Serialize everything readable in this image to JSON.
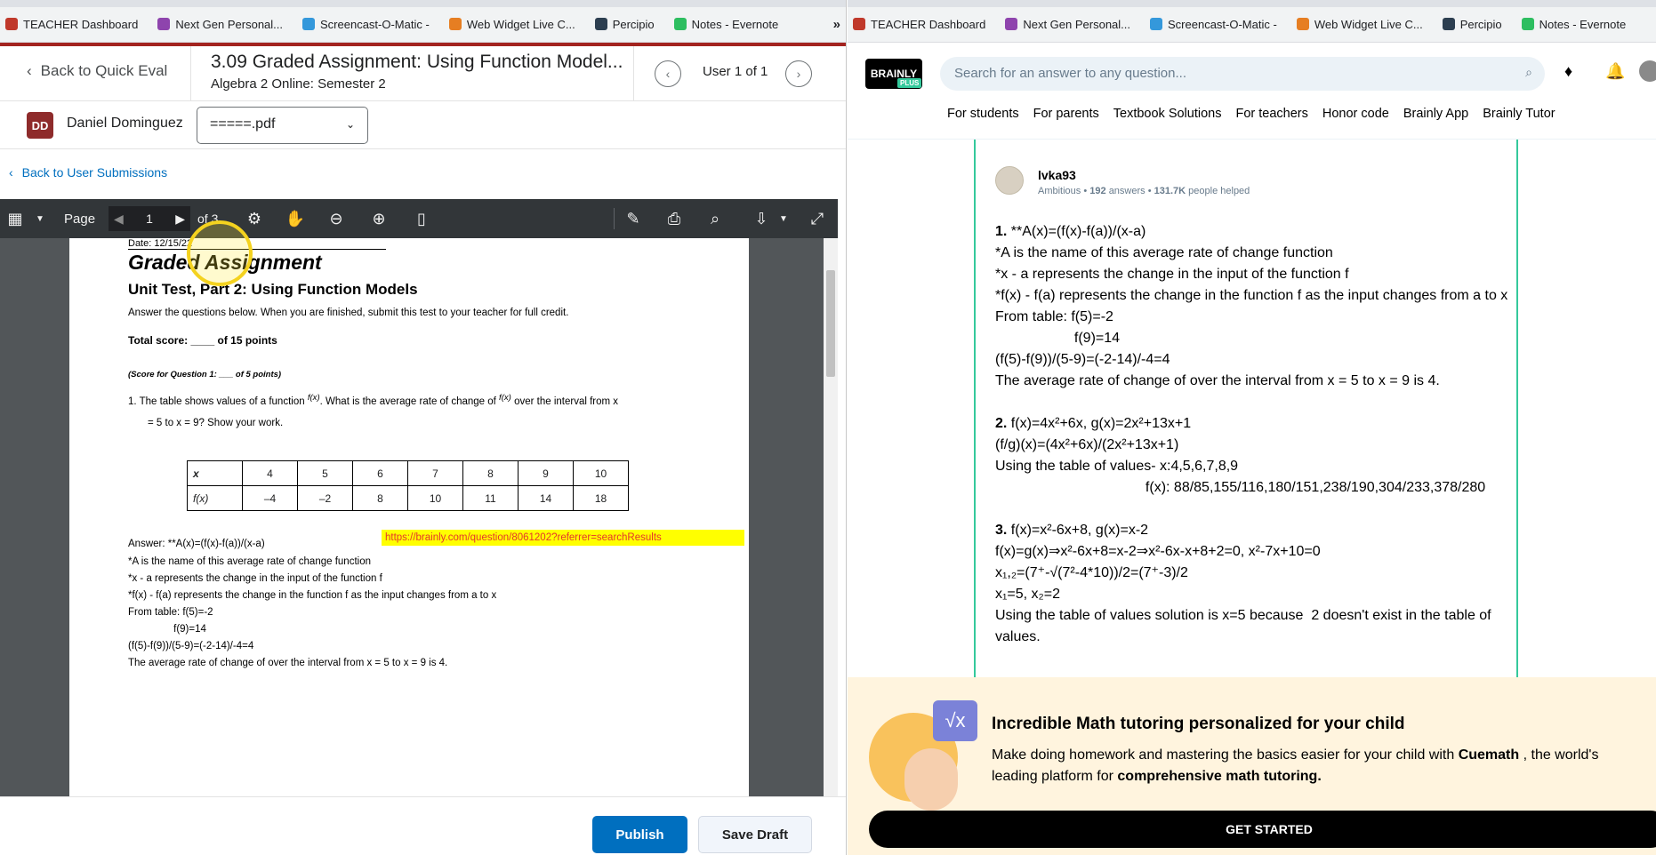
{
  "left_browser": {
    "bookmarks": [
      {
        "label": "TEACHER Dashboard",
        "icon": "teacher-dashboard-icon",
        "color": "#c0392b"
      },
      {
        "label": "Next Gen Personal...",
        "icon": "next-gen-icon",
        "color": "#8e44ad"
      },
      {
        "label": "Screencast-O-Matic -",
        "icon": "screencast-icon",
        "color": "#3498db"
      },
      {
        "label": "Web Widget Live C...",
        "icon": "web-widget-icon",
        "color": "#e67e22"
      },
      {
        "label": "Percipio",
        "icon": "percipio-icon",
        "color": "#2c3e50"
      },
      {
        "label": "Notes - Evernote",
        "icon": "evernote-icon",
        "color": "#2dbe60"
      }
    ],
    "more": "»"
  },
  "right_browser": {
    "bookmarks": [
      {
        "label": "TEACHER Dashboard",
        "icon": "teacher-dashboard-icon",
        "color": "#c0392b"
      },
      {
        "label": "Next Gen Personal...",
        "icon": "next-gen-icon",
        "color": "#8e44ad"
      },
      {
        "label": "Screencast-O-Matic -",
        "icon": "screencast-icon",
        "color": "#3498db"
      },
      {
        "label": "Web Widget Live C...",
        "icon": "web-widget-icon",
        "color": "#e67e22"
      },
      {
        "label": "Percipio",
        "icon": "percipio-icon",
        "color": "#2c3e50"
      },
      {
        "label": "Notes - Evernote",
        "icon": "evernote-icon",
        "color": "#2dbe60"
      }
    ]
  },
  "header": {
    "back_label": "Back to Quick Eval",
    "title": "3.09 Graded Assignment: Using Function Model...",
    "subtitle": "Algebra 2 Online: Semester 2",
    "user_of": "User 1 of 1"
  },
  "user": {
    "initials": "DD",
    "name": "Daniel Dominguez",
    "file_selected": "=====.pdf",
    "back_submissions": "Back to User Submissions"
  },
  "pdf_toolbar": {
    "page_label": "Page",
    "page_number": "1",
    "page_total": "of 3"
  },
  "pdf": {
    "date": "Date: 12/15/22",
    "heading": "Graded Assignment",
    "subheading": "Unit Test, Part 2: Using Function Models",
    "instructions": "Answer the questions below. When you are finished, submit this test to your teacher for full credit.",
    "total_score": "Total score: ____ of 15 points",
    "score_q1": "(Score for Question 1: ___ of 5 points)",
    "q1_part1": "1.   The table shows values of a function",
    "q1_fx": "f(x)",
    "q1_part2": ". What is the average rate of change of",
    "q1_fx2": "f(x)",
    "q1_part3": "over the interval from x",
    "q1_line2": "= 5 to x = 9? Show your work.",
    "table": {
      "header": [
        "x",
        "4",
        "5",
        "6",
        "7",
        "8",
        "9",
        "10"
      ],
      "row": [
        "f(x)",
        "–4",
        "–2",
        "8",
        "10",
        "11",
        "14",
        "18"
      ]
    },
    "answer_label": "Answer:  **A(x)=(f(x)-f(a))/(x-a)",
    "link": "https://brainly.com/question/8061202?referrer=searchResults",
    "lines": [
      "*A is the name of this average rate of change function",
      "*x - a represents the change in the input of the function f",
      "*f(x) - f(a) represents the change in the function f as the input changes from a to x",
      "From table: f(5)=-2",
      "                f(9)=14",
      "(f(5)-f(9))/(5-9)=(-2-14)/-4=4",
      "The average rate of change of over the interval from x = 5 to x = 9 is 4."
    ]
  },
  "footer": {
    "publish": "Publish",
    "save_draft": "Save Draft"
  },
  "brainly": {
    "logo": "BRAINLY",
    "plus": "PLUS",
    "search_placeholder": "Search for an answer to any question...",
    "nav": [
      "For students",
      "For parents",
      "Textbook Solutions",
      "For teachers",
      "Honor code",
      "Brainly App",
      "Brainly Tutor"
    ],
    "answerer": {
      "name": "lvka93",
      "rank": "Ambitious",
      "answers": "192",
      "answers_label": "answers",
      "helped": "131.7K",
      "helped_label": "people helped"
    },
    "answer_lines": [
      "1. **A(x)=(f(x)-f(a))/(x-a)",
      "*A is the name of this average rate of change function",
      "*x - a represents the change in the input of the function f",
      "*f(x) - f(a) represents the change in the function f as the input changes from a to x",
      "From table: f(5)=-2",
      "                    f(9)=14",
      "(f(5)-f(9))/(5-9)=(-2-14)/-4=4",
      "The average rate of change of over the interval from x = 5 to x = 9 is 4.",
      "",
      "2. f(x)=4x²+6x, g(x)=2x²+13x+1",
      "(f/g)(x)=(4x²+6x)/(2x²+13x+1)",
      "Using the table of values- x:4,5,6,7,8,9",
      "                                      f(x): 88/85,155/116,180/151,238/190,304/233,378/280",
      "",
      "3. f(x)=x²-6x+8, g(x)=x-2",
      "f(x)=g(x)⇒x²-6x+8=x-2⇒x²-6x-x+8+2=0, x²-7x+10=0",
      "x₁,₂=(7⁺-√(7²-4*10))/2=(7⁺-3)/2",
      "x₁=5, x₂=2",
      "Using the table of values solution is x=5 because  2 doesn't exist in the table of values."
    ],
    "promo": {
      "title": "Incredible Math tutoring personalized for your child",
      "text_pre": "Make doing homework and mastering the basics easier for your child with ",
      "brand": "Cuemath",
      "text_mid": " , the world's leading platform for ",
      "text_bold": "comprehensive math tutoring.",
      "button": "GET STARTED"
    }
  },
  "colors": {
    "d2l_red": "#a3231f",
    "primary_blue": "#006fbf",
    "brainly_green": "#35c99c",
    "promo_bg": "#fff4de"
  }
}
